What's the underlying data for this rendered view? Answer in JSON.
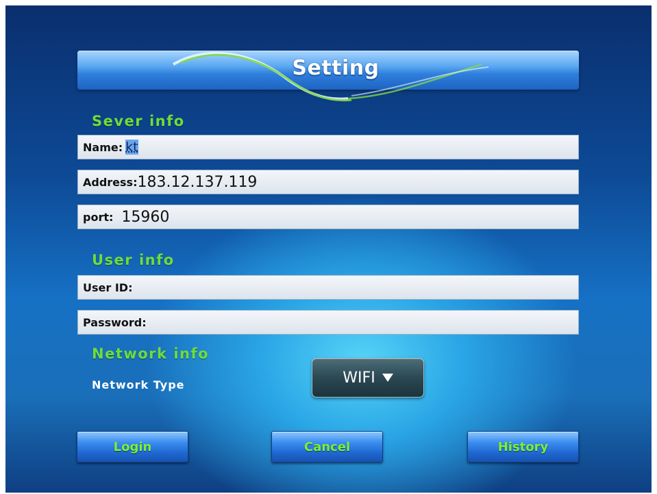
{
  "header": {
    "title": "Setting"
  },
  "server_section": {
    "heading": "Sever info",
    "name_label": "Name:",
    "name_value": "kt",
    "address_label": "Address:",
    "address_value": "183.12.137.119",
    "port_label": "port:",
    "port_value": "15960"
  },
  "user_section": {
    "heading": "User info",
    "user_id_label": "User ID:",
    "user_id_value": "",
    "password_label": "Password:",
    "password_value": ""
  },
  "network_section": {
    "heading": "Network info",
    "type_label": "Network Type",
    "type_selected": "WIFI"
  },
  "actions": {
    "login_label": "Login",
    "cancel_label": "Cancel",
    "history_label": "History"
  },
  "colors": {
    "heading_green": "#6fdc3c",
    "button_text_green": "#7df02f",
    "banner_blue": "#2f7fdc"
  }
}
